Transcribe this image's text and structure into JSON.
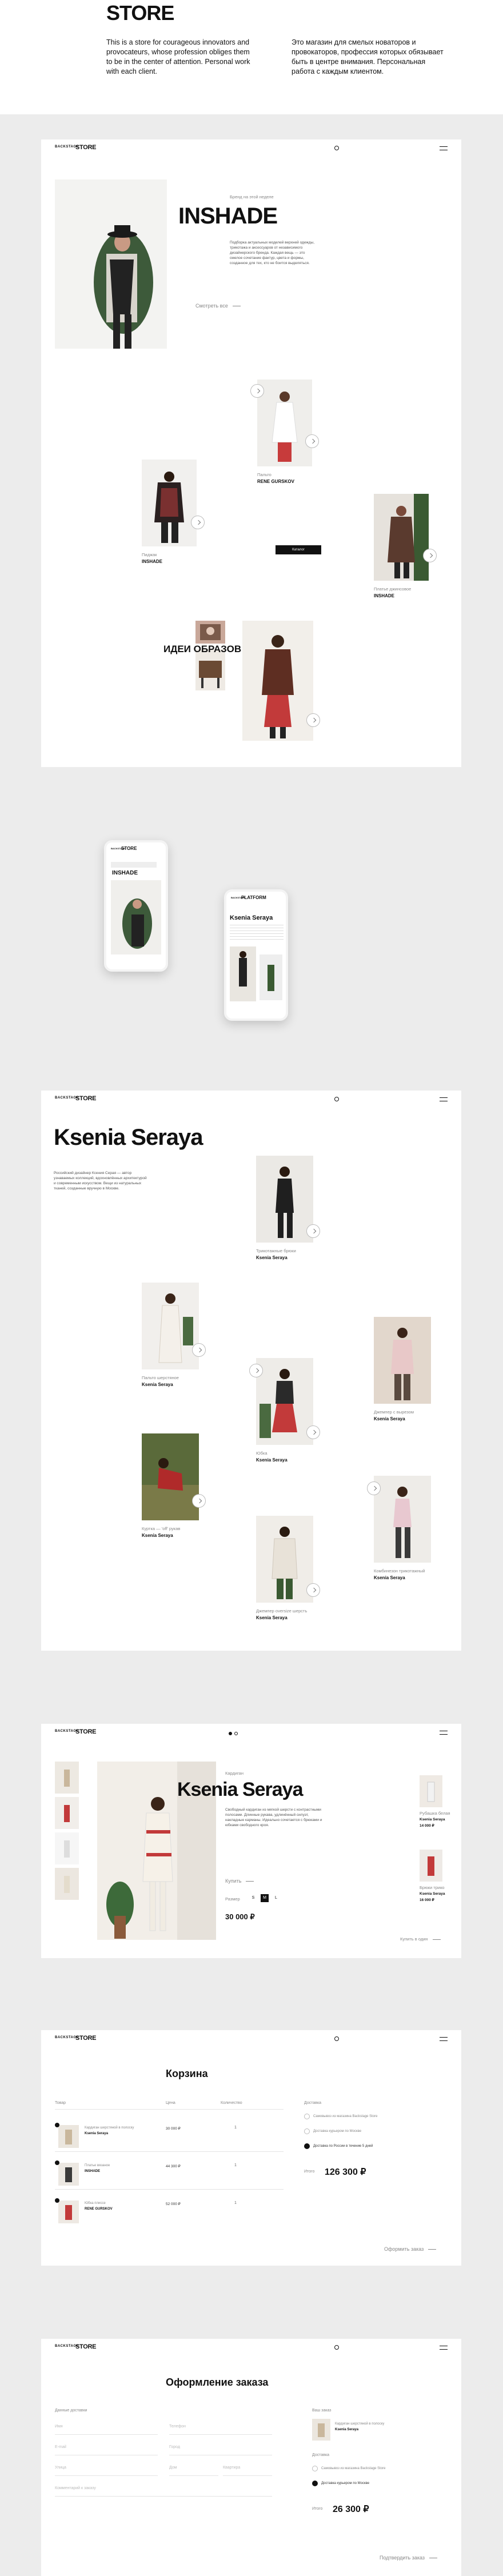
{
  "intro": {
    "title": "STORE",
    "text_en": "This is a store for courageous innovators and provocateurs, whose profession obliges them to be in the center of attention. Personal work with each client.",
    "text_ru": "Это магазин для смелых новаторов и провокаторов, профессия которых обязывает быть в центре внимания. Персональная работа с каждым клиентом."
  },
  "header": {
    "logo_small": "BACKSTAGE",
    "logo_big": "STORE",
    "logo_platform": "PLATFORM"
  },
  "home": {
    "kicker": "Бренд на этой неделе",
    "brand": "INSHADE",
    "desc": "Подборка актуальных моделей верхней одежды, трикотажа и аксессуаров от независимого дизайнерского бренда. Каждая вещь — это смелое сочетание фактур, цвета и формы, созданное для тех, кто не боится выделяться.",
    "more": "Смотреть все",
    "item1_cap": "Пальто",
    "item1_brand": "RENE GURSKOV",
    "item2_cap": "Пиджак",
    "item2_brand": "INSHADE",
    "item3_cap": "Платье джинсовое",
    "item3_brand": "INSHADE",
    "button": "Каталог",
    "ideas": "ИДЕИ ОБРАЗОВ"
  },
  "mobile": {
    "brand": "INSHADE",
    "designer": "Ksenia Seraya"
  },
  "designer": {
    "name": "Ksenia Seraya",
    "desc": "Российский дизайнер Ксения Серая — автор узнаваемых коллекций, вдохновлённых архитектурой и современным искусством. Вещи из натуральных тканей, созданные вручную в Москве.",
    "items": [
      {
        "cap": "Трикотажные брюки",
        "brand": "Ksenia Seraya"
      },
      {
        "cap": "Пальто шерстяное",
        "brand": "Ksenia Seraya"
      },
      {
        "cap": "Джемпер с вырезом",
        "brand": "Ksenia Seraya"
      },
      {
        "cap": "Юбка",
        "brand": "Ksenia Seraya"
      },
      {
        "cap": "Куртка — 'off' рукав",
        "brand": "Ksenia Seraya"
      },
      {
        "cap": "Комбинезон трикотажный",
        "brand": "Ksenia Seraya"
      },
      {
        "cap": "Джемпер oversize шерсть",
        "brand": "Ksenia Seraya"
      }
    ]
  },
  "product": {
    "kicker": "Кардиган",
    "name": "Ksenia Seraya",
    "desc": "Свободный кардиган из мягкой шерсти с контрастными полосами. Длинные рукава, удлинённый силуэт, накладные карманы. Идеально сочетается с брюками и юбками свободного кроя.",
    "sizes_label": "Размер",
    "size_vals": [
      "S",
      "M",
      "L"
    ],
    "more": "Купить",
    "price": "30 000 ₽",
    "side1": "Рубашка белая",
    "side1_brand": "Ksenia Seraya",
    "side1_price": "14 000 ₽",
    "side2": "Брюки трико",
    "side2_brand": "Ksenia Seraya",
    "side2_price": "16 000 ₽",
    "cart_link": "Купить в один"
  },
  "cart": {
    "title": "Корзина",
    "cols": [
      "Товар",
      "Цена",
      "Количество",
      "Доставка"
    ],
    "rows": [
      {
        "name": "Кардиган шерстяной в полоску",
        "brand": "Ksenia Seraya",
        "price": "30 000 ₽",
        "qty": "1"
      },
      {
        "name": "Платье вязаное",
        "brand": "INSHADE",
        "price": "44 300 ₽",
        "qty": "1"
      },
      {
        "name": "Юбка плиссе",
        "brand": "RENE GURSKOV",
        "price": "52 000 ₽",
        "qty": "1"
      }
    ],
    "delivery1": "Самовывоз из магазина Backstage Store",
    "delivery2": "Доставка курьером по Москве",
    "delivery3": "Доставка по России в течение 5 дней",
    "total_label": "Итого",
    "total": "126 300 ₽",
    "checkout": "Оформить заказ"
  },
  "order": {
    "title": "Оформление заказа",
    "contacts": "Данные доставки",
    "your_order": "Ваш заказ",
    "item_name": "Кардиган шерстяной в полоску",
    "item_brand": "Ksenia Seraya",
    "delivery": "Доставка",
    "d1": "Самовывоз из магазина Backstage Store",
    "d2": "Доставка курьером по Москве",
    "total_label": "Итого",
    "total": "26 300 ₽",
    "confirm": "Подтвердить заказ",
    "fields": [
      "Имя",
      "Телефон",
      "E-mail",
      "Город",
      "Улица",
      "Дом",
      "Квартира",
      "Комментарий к заказу"
    ]
  }
}
